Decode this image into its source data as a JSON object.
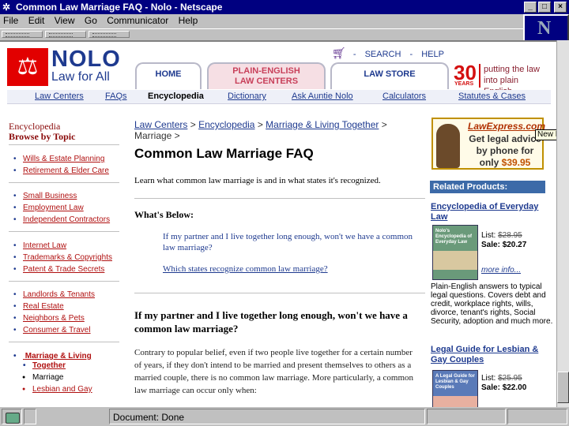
{
  "window": {
    "title": "Common Law Marriage FAQ - Nolo - Netscape",
    "controls": {
      "minimize": "_",
      "maximize": "□",
      "close": "×"
    }
  },
  "menu": [
    "File",
    "Edit",
    "View",
    "Go",
    "Communicator",
    "Help"
  ],
  "site": {
    "logo_name": "NOLO",
    "logo_tagline": "Law for All",
    "top_links": {
      "search": "SEARCH",
      "help": "HELP",
      "sep": "-"
    },
    "tabs": {
      "home": "HOME",
      "plain_english_1": "PLAIN-ENGLISH",
      "plain_english_2": "LAW CENTERS",
      "store": "LAW STORE"
    },
    "anniversary": {
      "number": "30",
      "years": "YEARS",
      "tagline_1": "putting the law",
      "tagline_2": "into plain English"
    },
    "subnav": [
      "Law Centers",
      "FAQs",
      "Encyclopedia",
      "Dictionary",
      "Ask Auntie Nolo",
      "Calculators",
      "Statutes & Cases"
    ]
  },
  "sidebar": {
    "heading": "Encyclopedia",
    "subheading": "Browse by Topic",
    "groups": [
      [
        "Wills & Estate Planning",
        "Retirement & Elder Care"
      ],
      [
        "Small Business",
        "Employment Law",
        "Independent Contractors"
      ],
      [
        "Internet Law",
        "Trademarks & Copyrights",
        "Patent & Trade Secrets"
      ],
      [
        "Landlords & Tenants",
        "Real Estate",
        "Neighbors & Pets",
        "Consumer & Travel"
      ]
    ],
    "marriage": {
      "label_1": "Marriage & Living",
      "label_2": "Together"
    },
    "marriage_sub": [
      "Marriage",
      "Lesbian and Gay"
    ]
  },
  "main": {
    "breadcrumb": {
      "c1": "Law Centers",
      "c2": "Encyclopedia",
      "c3": "Marriage & Living Together",
      "sep": ">",
      "c4": "Marriage >"
    },
    "title": "Common Law Marriage FAQ",
    "description": "Learn what common law marriage is and in what states it's recognized.",
    "whats_below": "What's Below:",
    "q1": "If my partner and I live together long enough, won't we have a common law marriage?",
    "q2": "Which states recognize common law marriage?",
    "q1_heading": "If my partner and I live together long enough, won't we have a common law marriage?",
    "answer": "Contrary to popular belief, even if two people live together for a certain number of years, if they don't intend to be married and present themselves to others as a married couple, there is no common law marriage. More particularly, a common law marriage can occur only when:"
  },
  "right": {
    "ad": {
      "brand": "LawExpress.com",
      "line1": "Get legal advice",
      "line2": "by phone for",
      "line3": "only",
      "price": "$39.95"
    },
    "tooltip": "New Message",
    "related_header": "Related Products:",
    "product1": {
      "title": "Encyclopedia of Everyday Law",
      "cover": "Nolo's Encyclopedia of Everyday Law",
      "list_label": "List:",
      "list_price": "$28.95",
      "sale_label": "Sale:",
      "sale_price": "$20.27",
      "more": "more info...",
      "desc": "Plain-English answers to typical legal questions. Covers debt and credit, workplace rights, wills, divorce, tenant's rights, Social Security, adoption and much more."
    },
    "product2": {
      "title": "Legal Guide for Lesbian & Gay Couples",
      "cover": "A Legal Guide for Lesbian & Gay Couples",
      "list_label": "List:",
      "list_price": "$25.95",
      "sale_label": "Sale:",
      "sale_price": "$22.00"
    }
  },
  "status": {
    "text": "Document: Done"
  },
  "colors": {
    "title_bar": "#000080",
    "nolo_blue": "#1e3a8f",
    "nolo_red": "#e20000",
    "link_red": "#b01010",
    "related_bar": "#3c6aa8"
  }
}
